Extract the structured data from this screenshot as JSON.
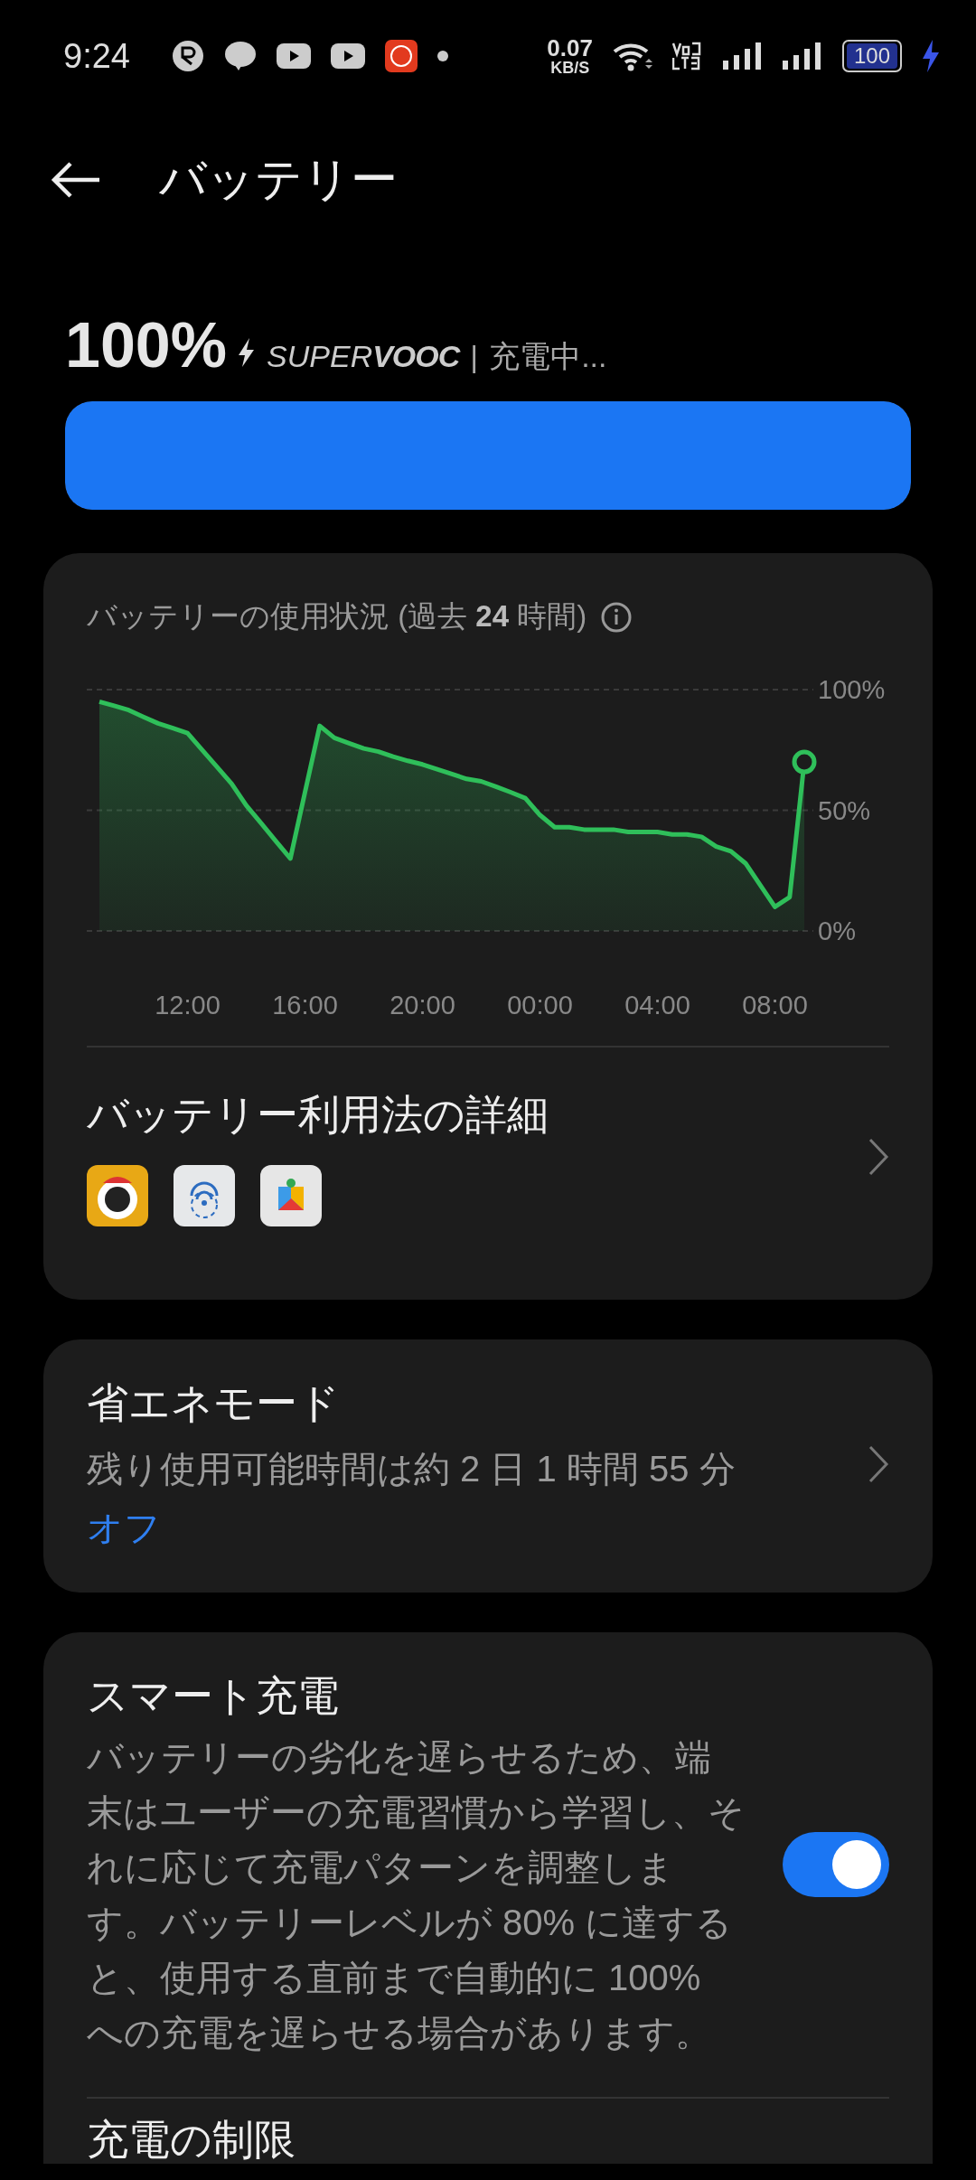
{
  "status_bar": {
    "time": "9:24",
    "speed": "0.07",
    "speed_unit": "KB/S",
    "battery": "100"
  },
  "header": {
    "title": "バッテリー"
  },
  "summary": {
    "percent": "100%",
    "brand_1": "SUPER",
    "brand_2": "VOOC",
    "separator": "|",
    "status": "充電中...",
    "level": 1
  },
  "usage": {
    "title": "バッテリーの使用状況 (過去 **24** 時間)",
    "chart_data": {
      "type": "area",
      "categories": [
        null,
        null,
        null,
        null,
        null,
        null,
        "12:00",
        null,
        null,
        null,
        null,
        null,
        null,
        null,
        "16:00",
        null,
        null,
        null,
        null,
        null,
        null,
        null,
        "20:00",
        null,
        null,
        null,
        null,
        null,
        null,
        null,
        "00:00",
        null,
        null,
        null,
        null,
        null,
        null,
        null,
        "04:00",
        null,
        null,
        null,
        null,
        null,
        null,
        null,
        "08:00",
        null,
        null
      ],
      "series": [
        {
          "color": "#2fbf5a",
          "values": [
            95,
            93.3,
            91.5,
            88.7,
            86,
            84,
            82,
            75,
            68,
            61,
            52,
            44.7,
            37.3,
            30,
            57.5,
            85,
            80,
            77.8,
            75.6,
            74.3,
            72.2,
            70.5,
            69,
            67,
            65,
            63,
            62,
            59.8,
            57.5,
            55,
            48,
            43,
            43,
            42,
            42,
            42,
            41,
            41,
            41,
            40,
            40,
            39,
            35,
            33,
            28,
            19,
            10,
            14,
            70
          ]
        }
      ],
      "ylim": [
        0,
        100
      ],
      "yticks": [
        {
          "value": 0,
          "label": "0%"
        },
        {
          "value": 50,
          "label": "50%"
        },
        {
          "value": 100,
          "label": "100%"
        }
      ]
    },
    "details": {
      "title": "バッテリー利用法の詳細"
    }
  },
  "power_saving": {
    "title": "省エネモード",
    "subtitle": "残り使用可能時間は約 2 日 1 時間 55 分",
    "state": "オフ"
  },
  "smart_charging": {
    "title": "スマート充電",
    "description": "バッテリーの劣化を遅らせるため、端末はユーザーの充電習慣から学習し、それに応じて充電パターンを調整します。バッテリーレベルが 80% に達すると、使用する直前まで自動的に 100% への充電を遅らせる場合があります。",
    "on": true
  },
  "charge_limit": {
    "title": "充電の制限"
  }
}
